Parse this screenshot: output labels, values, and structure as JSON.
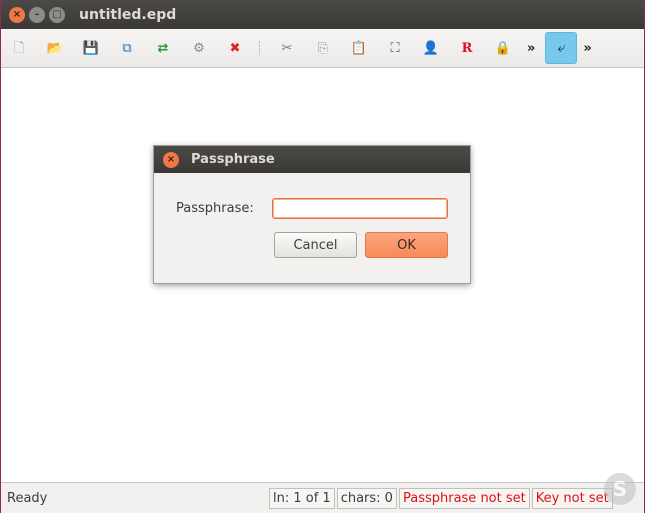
{
  "window": {
    "title": "untitled.epd",
    "close_glyph": "×",
    "min_glyph": "–",
    "max_glyph": "□"
  },
  "toolbar": {
    "items": [
      {
        "name": "new-file",
        "icon": "new-file-icon",
        "glyph": "🗋",
        "color": "#9a9a9a"
      },
      {
        "name": "open",
        "icon": "folder-open-icon",
        "glyph": "📂",
        "color": "#e0a23a"
      },
      {
        "name": "save",
        "icon": "save-icon",
        "glyph": "💾",
        "color": "#2f6db5"
      },
      {
        "name": "save-as",
        "icon": "save-as-icon",
        "glyph": "⧉",
        "color": "#2f6db5"
      },
      {
        "name": "shuffle",
        "icon": "shuffle-icon",
        "glyph": "⇄",
        "color": "#2a9a3a"
      },
      {
        "name": "properties",
        "icon": "document-settings-icon",
        "glyph": "⚙",
        "color": "#8a8a8a"
      },
      {
        "name": "close-file",
        "icon": "close-red-icon",
        "glyph": "✖",
        "color": "#e02424"
      },
      {
        "name": "cut",
        "icon": "scissors-icon",
        "glyph": "✂",
        "color": "#7a7a7a"
      },
      {
        "name": "copy",
        "icon": "copy-icon",
        "glyph": "⎘",
        "color": "#9a9a9a"
      },
      {
        "name": "paste",
        "icon": "paste-icon",
        "glyph": "📋",
        "color": "#d9a441"
      },
      {
        "name": "binoculars",
        "icon": "binoculars-icon",
        "glyph": "⛶",
        "color": "#4a4a4a"
      },
      {
        "name": "user",
        "icon": "user-icon",
        "glyph": "👤",
        "color": "#c0392b"
      },
      {
        "name": "reference",
        "icon": "letter-r-icon",
        "glyph": "R",
        "color": "#e0102a"
      },
      {
        "name": "lock",
        "icon": "lock-icon",
        "glyph": "🔒",
        "color": "#d9a441"
      }
    ],
    "more_glyph": "»",
    "wrap_glyph": "⤶"
  },
  "dialog": {
    "title": "Passphrase",
    "close_glyph": "×",
    "label": "Passphrase:",
    "input_value": "",
    "cancel_label": "Cancel",
    "ok_label": "OK"
  },
  "statusbar": {
    "ready": "Ready",
    "position": "ln: 1 of 1",
    "chars": "chars: 0",
    "passphrase_status": "Passphrase not set",
    "key_status": "Key not set"
  }
}
